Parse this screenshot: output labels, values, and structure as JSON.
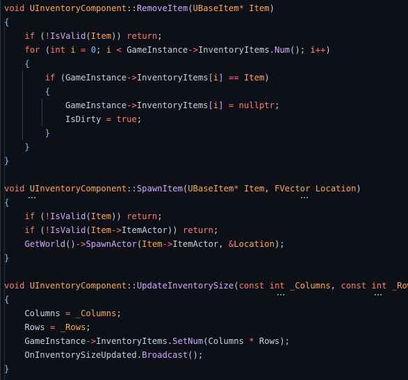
{
  "editor": {
    "language": "cpp",
    "colors": {
      "background": "#0d1117",
      "keyword": "#ff7b72",
      "type": "#ffa657",
      "function": "#d2a8ff",
      "text": "#c9d1d9",
      "brace": "#79c0ff",
      "warning_squiggle": "#3fb950"
    },
    "lines": [
      [
        [
          "kw",
          "void"
        ],
        [
          "plain",
          " "
        ],
        [
          "type",
          "UInventoryComponent"
        ],
        [
          "punc",
          "::"
        ],
        [
          "fn",
          "RemoveItem"
        ],
        [
          "punc",
          "("
        ],
        [
          "type",
          "UBaseItem"
        ],
        [
          "op",
          "*"
        ],
        [
          "plain",
          " "
        ],
        [
          "param",
          "Item"
        ],
        [
          "punc",
          ")"
        ]
      ],
      [
        [
          "brace",
          "{"
        ]
      ],
      [
        [
          "plain",
          "    "
        ],
        [
          "kw",
          "if"
        ],
        [
          "punc",
          " ("
        ],
        [
          "op",
          "!"
        ],
        [
          "fn",
          "IsValid"
        ],
        [
          "punc",
          "("
        ],
        [
          "param",
          "Item"
        ],
        [
          "punc",
          "))"
        ],
        [
          "plain",
          " "
        ],
        [
          "kw",
          "return"
        ],
        [
          "punc",
          ";"
        ]
      ],
      [
        [
          "plain",
          "    "
        ],
        [
          "kw",
          "for"
        ],
        [
          "punc",
          " ("
        ],
        [
          "kw",
          "int"
        ],
        [
          "plain",
          " "
        ],
        [
          "type",
          "i"
        ],
        [
          "plain",
          " "
        ],
        [
          "op",
          "="
        ],
        [
          "plain",
          " "
        ],
        [
          "num",
          "0"
        ],
        [
          "punc",
          ";"
        ],
        [
          "plain",
          " "
        ],
        [
          "type",
          "i"
        ],
        [
          "plain",
          " "
        ],
        [
          "op",
          "<"
        ],
        [
          "plain",
          " GameInstance"
        ],
        [
          "op",
          "->"
        ],
        [
          "plain",
          "InventoryItems."
        ],
        [
          "fn",
          "Num"
        ],
        [
          "punc",
          "();"
        ],
        [
          "plain",
          " "
        ],
        [
          "type",
          "i"
        ],
        [
          "op",
          "++"
        ],
        [
          "punc",
          ")"
        ]
      ],
      [
        [
          "plain",
          "    "
        ],
        [
          "brace",
          "{"
        ]
      ],
      [
        [
          "plain",
          "        "
        ],
        [
          "kw",
          "if"
        ],
        [
          "punc",
          " ("
        ],
        [
          "plain",
          "GameInstance"
        ],
        [
          "op",
          "->"
        ],
        [
          "plain",
          "InventoryItems"
        ],
        [
          "fn",
          "["
        ],
        [
          "type",
          "i"
        ],
        [
          "fn",
          "]"
        ],
        [
          "plain",
          " "
        ],
        [
          "op",
          "=="
        ],
        [
          "plain",
          " "
        ],
        [
          "param",
          "Item"
        ],
        [
          "punc",
          ")"
        ]
      ],
      [
        [
          "plain",
          "        "
        ],
        [
          "brace",
          "{"
        ]
      ],
      [
        [
          "plain",
          "            GameInstance"
        ],
        [
          "op",
          "->"
        ],
        [
          "plain",
          "InventoryItems"
        ],
        [
          "fn",
          "["
        ],
        [
          "type",
          "i"
        ],
        [
          "fn",
          "]"
        ],
        [
          "plain",
          " "
        ],
        [
          "op",
          "="
        ],
        [
          "plain",
          " "
        ],
        [
          "kw",
          "nullptr"
        ],
        [
          "punc",
          ";"
        ]
      ],
      [
        [
          "plain",
          "            IsDirty "
        ],
        [
          "op",
          "="
        ],
        [
          "plain",
          " "
        ],
        [
          "kw",
          "true"
        ],
        [
          "punc",
          ";"
        ]
      ],
      [
        [
          "plain",
          "        "
        ],
        [
          "brace",
          "}"
        ]
      ],
      [
        [
          "plain",
          "    "
        ],
        [
          "brace",
          "}"
        ]
      ],
      [
        [
          "brace",
          "}"
        ]
      ],
      [
        [
          "plain",
          ""
        ]
      ],
      [
        [
          "kw",
          "void"
        ],
        [
          "plain",
          " "
        ],
        [
          "type",
          "UInventoryComponent"
        ],
        [
          "punc",
          "::"
        ],
        [
          "fn",
          "SpawnItem"
        ],
        [
          "punc",
          "("
        ],
        [
          "type",
          "UBaseItem"
        ],
        [
          "op",
          "*"
        ],
        [
          "plain",
          " "
        ],
        [
          "param",
          "Item"
        ],
        [
          "punc",
          ", "
        ],
        [
          "type",
          "FVector"
        ],
        [
          "plain",
          " "
        ],
        [
          "param",
          "Location"
        ],
        [
          "punc",
          ")"
        ]
      ],
      [
        [
          "brace",
          "{"
        ]
      ],
      [
        [
          "plain",
          "    "
        ],
        [
          "kw",
          "if"
        ],
        [
          "punc",
          " ("
        ],
        [
          "op",
          "!"
        ],
        [
          "fn",
          "IsValid"
        ],
        [
          "punc",
          "("
        ],
        [
          "param",
          "Item"
        ],
        [
          "punc",
          "))"
        ],
        [
          "plain",
          " "
        ],
        [
          "kw",
          "return"
        ],
        [
          "punc",
          ";"
        ]
      ],
      [
        [
          "plain",
          "    "
        ],
        [
          "kw",
          "if"
        ],
        [
          "punc",
          " ("
        ],
        [
          "op",
          "!"
        ],
        [
          "fn",
          "IsValid"
        ],
        [
          "punc",
          "("
        ],
        [
          "param",
          "Item"
        ],
        [
          "op",
          "->"
        ],
        [
          "plain",
          "ItemActor"
        ],
        [
          "punc",
          "))"
        ],
        [
          "plain",
          " "
        ],
        [
          "kw",
          "return"
        ],
        [
          "punc",
          ";"
        ]
      ],
      [
        [
          "plain",
          "    "
        ],
        [
          "fn",
          "GetWorld"
        ],
        [
          "punc",
          "()"
        ],
        [
          "op",
          "->"
        ],
        [
          "fn",
          "SpawnActor"
        ],
        [
          "punc",
          "("
        ],
        [
          "param",
          "Item"
        ],
        [
          "op",
          "->"
        ],
        [
          "plain",
          "ItemActor, "
        ],
        [
          "op",
          "&"
        ],
        [
          "param",
          "Location"
        ],
        [
          "punc",
          ");"
        ]
      ],
      [
        [
          "brace",
          "}"
        ]
      ],
      [
        [
          "plain",
          ""
        ]
      ],
      [
        [
          "kw",
          "void"
        ],
        [
          "plain",
          " "
        ],
        [
          "type",
          "UInventoryComponent"
        ],
        [
          "punc",
          "::"
        ],
        [
          "fn",
          "UpdateInventorySize"
        ],
        [
          "punc",
          "("
        ],
        [
          "kw",
          "const"
        ],
        [
          "plain",
          " "
        ],
        [
          "kw",
          "int"
        ],
        [
          "plain",
          " "
        ],
        [
          "param",
          "_Columns"
        ],
        [
          "punc",
          ", "
        ],
        [
          "kw",
          "const"
        ],
        [
          "plain",
          " "
        ],
        [
          "kw",
          "int"
        ],
        [
          "plain",
          " "
        ],
        [
          "param",
          "_Rows"
        ],
        [
          "punc",
          ")"
        ]
      ],
      [
        [
          "brace",
          "{"
        ]
      ],
      [
        [
          "plain",
          "    Columns "
        ],
        [
          "op",
          "="
        ],
        [
          "plain",
          " "
        ],
        [
          "param",
          "_Columns"
        ],
        [
          "punc",
          ";"
        ]
      ],
      [
        [
          "plain",
          "    Rows "
        ],
        [
          "op",
          "="
        ],
        [
          "plain",
          " "
        ],
        [
          "param",
          "_Rows"
        ],
        [
          "punc",
          ";"
        ]
      ],
      [
        [
          "plain",
          "    GameInstance"
        ],
        [
          "op",
          "->"
        ],
        [
          "plain",
          "InventoryItems."
        ],
        [
          "fn",
          "SetNum"
        ],
        [
          "punc",
          "("
        ],
        [
          "plain",
          "Columns "
        ],
        [
          "op",
          "*"
        ],
        [
          "plain",
          " Rows"
        ],
        [
          "punc",
          ");"
        ]
      ],
      [
        [
          "plain",
          "    OnInventorySizeUpdated."
        ],
        [
          "fn",
          "Broadcast"
        ],
        [
          "punc",
          "();"
        ]
      ],
      [
        [
          "brace",
          "}"
        ]
      ]
    ]
  }
}
